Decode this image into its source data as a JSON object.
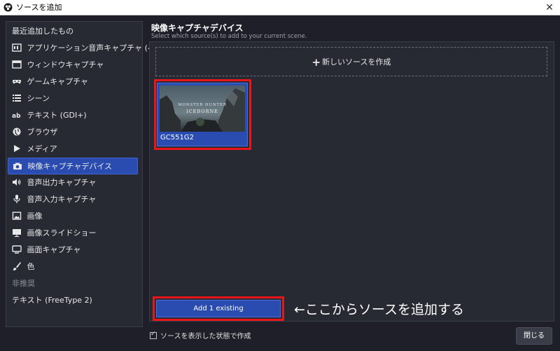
{
  "window": {
    "title": "ソースを追加"
  },
  "sidebar": {
    "items": [
      {
        "label": "最近追加したもの",
        "icon": "none"
      },
      {
        "label": "アプリケーション音声キャプチャ (ベータ版)",
        "icon": "app-audio-icon"
      },
      {
        "label": "ウィンドウキャプチャ",
        "icon": "window-icon"
      },
      {
        "label": "ゲームキャプチャ",
        "icon": "gamepad-icon"
      },
      {
        "label": "シーン",
        "icon": "list-icon"
      },
      {
        "label": "テキスト (GDI+)",
        "icon": "text-ab-icon"
      },
      {
        "label": "ブラウザ",
        "icon": "globe-icon"
      },
      {
        "label": "メディア",
        "icon": "play-icon"
      },
      {
        "label": "映像キャプチャデバイス",
        "icon": "camera-icon",
        "selected": true
      },
      {
        "label": "音声出力キャプチャ",
        "icon": "speaker-icon"
      },
      {
        "label": "音声入力キャプチャ",
        "icon": "microphone-icon"
      },
      {
        "label": "画像",
        "icon": "image-icon"
      },
      {
        "label": "画像スライドショー",
        "icon": "slideshow-icon"
      },
      {
        "label": "画面キャプチャ",
        "icon": "monitor-icon"
      },
      {
        "label": "色",
        "icon": "brush-icon"
      },
      {
        "label": "非推奨",
        "icon": "none",
        "muted": true
      },
      {
        "label": "テキスト (FreeType 2)",
        "icon": "none"
      }
    ]
  },
  "main": {
    "heading": "映像キャプチャデバイス",
    "subheading": "Select which source(s) to add to your current scene.",
    "create_new_label": "新しいソースを作成",
    "existing_sources": [
      {
        "name": "GC551G2",
        "thumbnail_title": "MONSTER HUNTER",
        "thumbnail_subtitle": "ICEBORNE"
      }
    ],
    "add_existing_label": "Add 1 existing",
    "annotation": "←ここからソースを追加する"
  },
  "footer": {
    "visible_checkbox_label": "ソースを表示した状態で作成",
    "visible_checked": true,
    "close_label": "閉じる"
  },
  "colors": {
    "accent": "#2a4cb0",
    "highlight_box": "#e8161a",
    "background": "#1e1f29",
    "panel": "#272a33"
  }
}
